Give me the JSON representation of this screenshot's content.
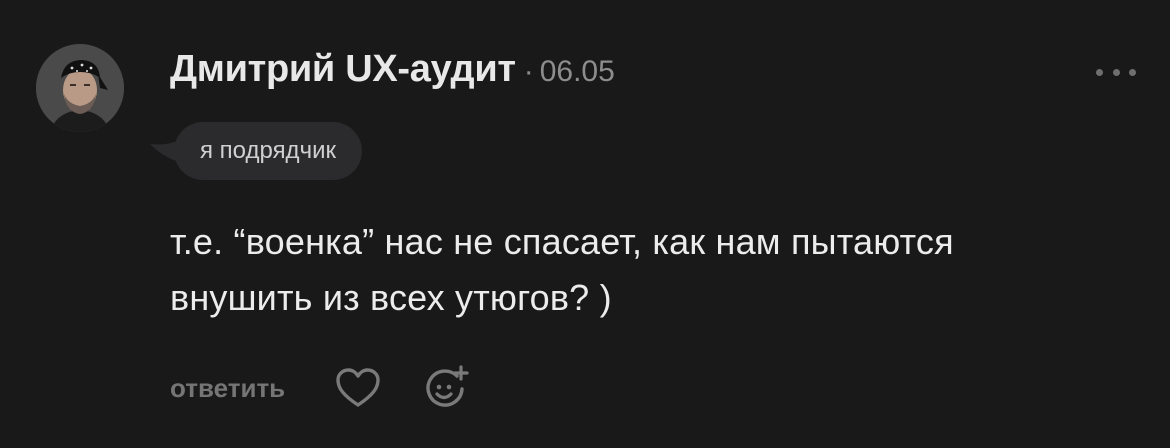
{
  "comment": {
    "author": "Дмитрий UX-аудит",
    "separator": "·",
    "date": "06.05",
    "reply_to": "я подрядчик",
    "text_line1": "т.е. “военка” нас не спасает, как нам пытаются",
    "text_line2": "внушить из всех утюгов? )"
  },
  "actions": {
    "reply_label": "ответить"
  },
  "icons": {
    "more": "more-horizontal-icon",
    "like": "heart-icon",
    "react": "add-reaction-icon"
  },
  "colors": {
    "background": "#1a191a",
    "text": "#ececec",
    "muted": "#757575",
    "badge_bg": "#2b2a2c"
  }
}
